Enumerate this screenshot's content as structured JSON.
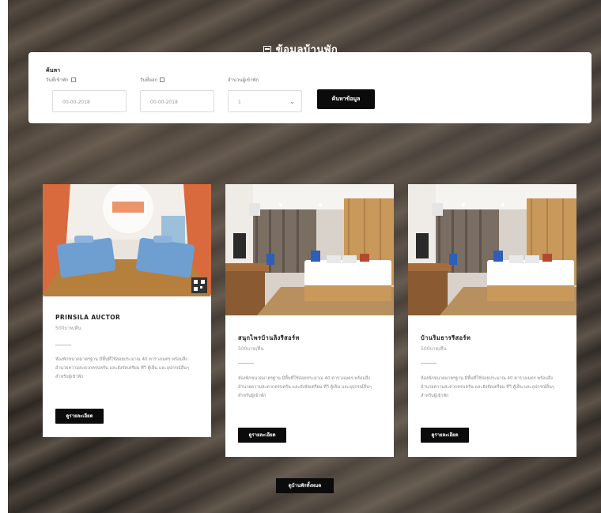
{
  "page": {
    "title": "ข้อมูลบ้านพัก",
    "more_button": "ดูบ้านพักทั้งหมด"
  },
  "search": {
    "heading": "ค้นหา",
    "checkin_label": "วันที่เข้าพัก",
    "checkin_value": "00-00-2018",
    "checkout_label": "วันที่ออก",
    "checkout_value": "00-00-2018",
    "guests_label": "จำนวนผู้เข้าพัก",
    "guests_value": "1",
    "button_label": "ค้นหาข้อมูล"
  },
  "cards": [
    {
      "title": "PRINSILA AUCTOR",
      "subtitle": "500บาท/คืน",
      "description": "ห้องพักขนาดมาตรฐาน มีพื้นที่ใช้สอยประมาณ 40 ตารางเมตร พร้อมสิ่งอำนวยความสะดวกครบครัน และยังจัดเตรียม ทีวี ตู้เย็น และอุปกรณ์อื่นๆ สำหรับผู้เข้าพัก",
      "button": "ดูรายละเอียด"
    },
    {
      "title": "สนุกไพรบ้านลิงรีสอร์ท",
      "subtitle": "500บาท/คืน",
      "description": "ห้องพักขนาดมาตรฐาน มีพื้นที่ใช้สอยประมาณ 40 ตารางเมตร พร้อมสิ่งอำนวยความสะดวกครบครัน และยังจัดเตรียม ทีวี ตู้เย็น และอุปกรณ์อื่นๆ สำหรับผู้เข้าพัก",
      "button": "ดูรายละเอียด"
    },
    {
      "title": "บ้านริมธารรีสอร์ท",
      "subtitle": "500บาท/คืน",
      "description": "ห้องพักขนาดมาตรฐาน มีพื้นที่ใช้สอยประมาณ 40 ตารางเมตร พร้อมสิ่งอำนวยความสะดวกครบครัน และยังจัดเตรียม ทีวี ตู้เย็น และอุปกรณ์อื่นๆ สำหรับผู้เข้าพัก",
      "button": "ดูรายละเอียด"
    }
  ],
  "colors": {
    "button_bg": "#0b0b0b",
    "panel_bg": "#ffffff",
    "page_bg": "#3a3530"
  },
  "icons": [
    "building-icon",
    "calendar-icon",
    "chevron-down-icon",
    "qr-code-icon"
  ]
}
